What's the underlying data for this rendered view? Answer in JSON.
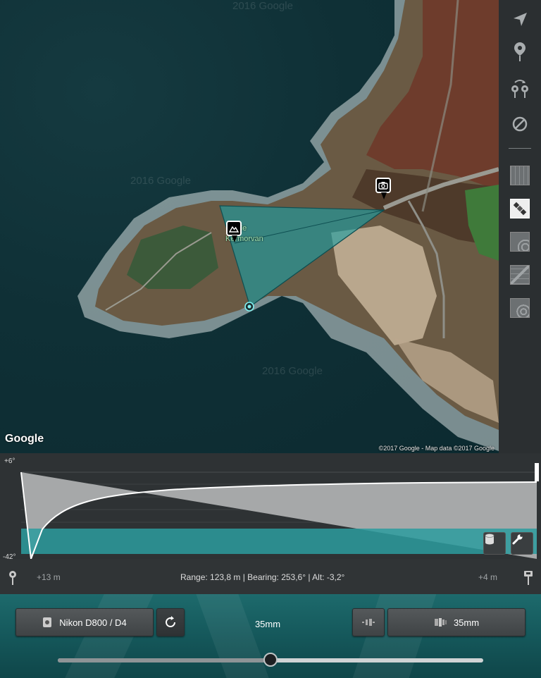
{
  "map": {
    "google_logo": "Google",
    "credit": "©2017 Google - Map data ©2017 Google",
    "watermark": "2016 Google",
    "place_label_line1": "de",
    "place_label_line2": "Kermorvan",
    "camera_marker_icon": "camera-icon",
    "subject_marker_icon": "mountain-icon",
    "target_marker_icon": "target-circle-icon",
    "cone_color": "#1a9ea3"
  },
  "toolbar": {
    "items": [
      "location-arrow-icon",
      "pin-icon",
      "swap-pins-icon",
      "no-entry-icon",
      "grid-overlay-icon",
      "satellite-icon",
      "terrain-icon",
      "hybrid-icon",
      "topo-icon"
    ]
  },
  "profile": {
    "max_label": "+6°",
    "min_label": "-42°",
    "left_distance": "+13 m",
    "right_distance": "+4 m",
    "fill_color": "#a6a8a9",
    "band_color": "#2b9c9f"
  },
  "info": {
    "summary": "Range: 123,8 m | Bearing: 253,6° | Alt: -3,2°"
  },
  "bottom": {
    "camera_label": "Nikon D800 / D4",
    "focal_center": "35mm",
    "lens_label": "35mm",
    "slider_value": 0.5
  }
}
